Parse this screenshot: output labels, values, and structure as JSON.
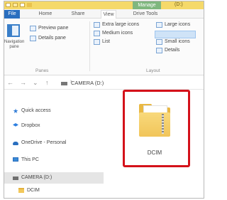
{
  "tabs": {
    "file": "File",
    "home": "Home",
    "share": "Share",
    "view": "View",
    "drive_tools": "Drive Tools",
    "manage": "Manage",
    "title_short": "(D:)"
  },
  "ribbon": {
    "navigation_pane": "Navigation pane",
    "preview_pane": "Preview pane",
    "details_pane": "Details pane",
    "panes_group": "Panes",
    "layout": {
      "extra_large": "Extra large icons",
      "large": "Large icons",
      "medium": "Medium icons",
      "small": "Small icons",
      "list": "List",
      "details": "Details",
      "group_label": "Layout"
    }
  },
  "address": {
    "back": "←",
    "forward": "→",
    "recent": "⌄",
    "up": "↑",
    "path": "CAMERA (D:)"
  },
  "nav_pane": [
    {
      "label": "Quick access",
      "icon": "star-icon"
    },
    {
      "label": "Dropbox",
      "icon": "dropbox-icon"
    },
    {
      "label": "OneDrive - Personal",
      "icon": "onedrive-icon"
    },
    {
      "label": "This PC",
      "icon": "pc-icon"
    },
    {
      "label": "CAMERA (D:)",
      "icon": "drive-icon"
    },
    {
      "label": "DCIM",
      "icon": "folder-icon"
    }
  ],
  "content": {
    "folder_name": "DCIM"
  },
  "colors": {
    "highlight": "#d4111a",
    "manage_tab": "#7fb77e",
    "file_tab": "#2a6fbf"
  }
}
